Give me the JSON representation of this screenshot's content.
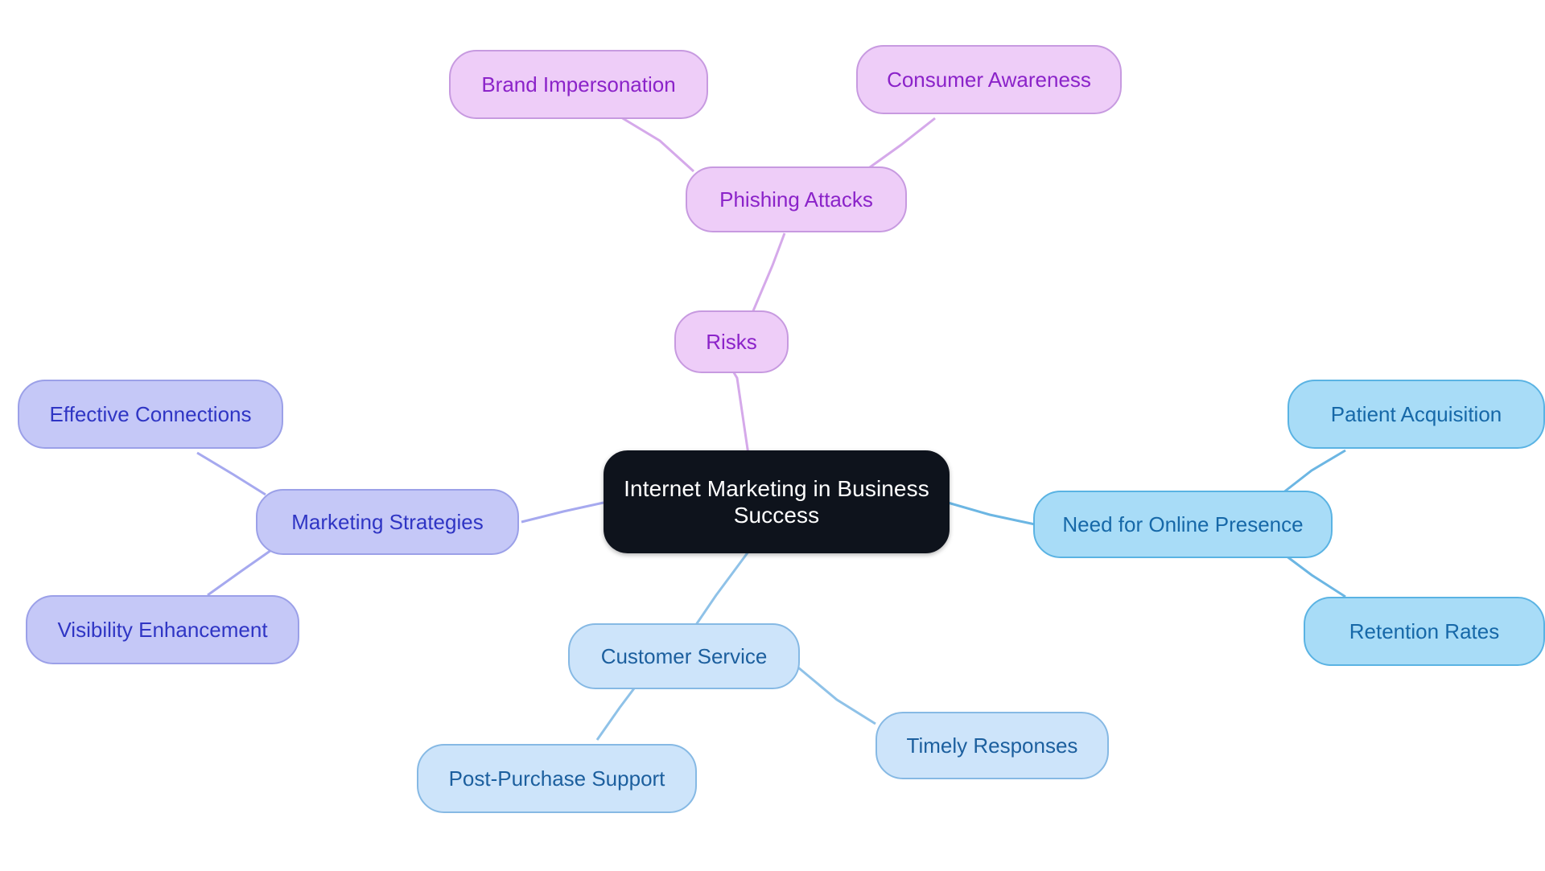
{
  "diagram": {
    "type": "mindmap",
    "title": "Internet Marketing in Business Success",
    "background": "#ffffff",
    "palette": {
      "root_fill": "#0e131c",
      "root_text": "#ffffff",
      "purple_fill": "#eecdf8",
      "purple_border": "#c79ae0",
      "purple_text": "#8b23c9",
      "periwinkle_fill": "#c5c8f7",
      "periwinkle_border": "#9ba0e8",
      "periwinkle_text": "#2f35c4",
      "blue_fill": "#a8dcf7",
      "blue_border": "#5ab3e3",
      "blue_text": "#1668a8",
      "lightblue_fill": "#cde4fa",
      "lightblue_border": "#86b9e4",
      "lightblue_text": "#1c5f9e"
    }
  },
  "nodes": {
    "root": {
      "label": "Internet Marketing in Business\nSuccess"
    },
    "risks": {
      "label": "Risks"
    },
    "phishing_attacks": {
      "label": "Phishing Attacks"
    },
    "brand_impersonation": {
      "label": "Brand Impersonation"
    },
    "consumer_awareness": {
      "label": "Consumer Awareness"
    },
    "marketing_strategies": {
      "label": "Marketing Strategies"
    },
    "effective_connections": {
      "label": "Effective Connections"
    },
    "visibility_enhancement": {
      "label": "Visibility Enhancement"
    },
    "online_presence": {
      "label": "Need for Online Presence"
    },
    "patient_acquisition": {
      "label": "Patient Acquisition"
    },
    "retention_rates": {
      "label": "Retention Rates"
    },
    "customer_service": {
      "label": "Customer Service"
    },
    "post_purchase_support": {
      "label": "Post-Purchase Support"
    },
    "timely_responses": {
      "label": "Timely Responses"
    }
  },
  "edges": [
    {
      "from": "root",
      "to": "risks",
      "color": "#d5a9ea"
    },
    {
      "from": "risks",
      "to": "phishing_attacks",
      "color": "#d5a9ea"
    },
    {
      "from": "phishing_attacks",
      "to": "brand_impersonation",
      "color": "#d5a9ea"
    },
    {
      "from": "phishing_attacks",
      "to": "consumer_awareness",
      "color": "#d5a9ea"
    },
    {
      "from": "root",
      "to": "marketing_strategies",
      "color": "#a6a9ef"
    },
    {
      "from": "marketing_strategies",
      "to": "effective_connections",
      "color": "#a6a9ef"
    },
    {
      "from": "marketing_strategies",
      "to": "visibility_enhancement",
      "color": "#a6a9ef"
    },
    {
      "from": "root",
      "to": "online_presence",
      "color": "#6cb6e3"
    },
    {
      "from": "online_presence",
      "to": "patient_acquisition",
      "color": "#6cb6e3"
    },
    {
      "from": "online_presence",
      "to": "retention_rates",
      "color": "#6cb6e3"
    },
    {
      "from": "root",
      "to": "customer_service",
      "color": "#8fc2e8"
    },
    {
      "from": "customer_service",
      "to": "post_purchase_support",
      "color": "#8fc2e8"
    },
    {
      "from": "customer_service",
      "to": "timely_responses",
      "color": "#8fc2e8"
    }
  ]
}
